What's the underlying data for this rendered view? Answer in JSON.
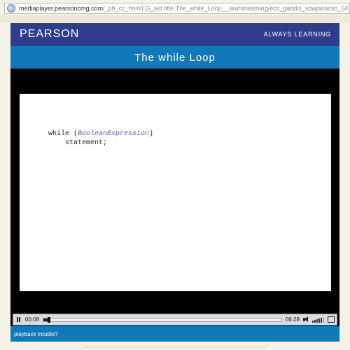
{
  "browser": {
    "url_host": "mediaplayer.pearsoncmg.com",
    "url_path": "/_ph_cc_hsmlLG_set.title.The_while_Loop__/aw/streaming/ecs_gaddis_sowjavacso_5/C"
  },
  "header": {
    "logo": "PEARSON",
    "tagline": "ALWAYS LEARNING"
  },
  "video": {
    "title": "The while Loop",
    "code_keyword": "while (",
    "code_expression": "BooleanExpression",
    "code_close": ")",
    "code_statement": "statement;"
  },
  "controls": {
    "current_time": "00:08",
    "duration": "06:28",
    "progress": 0.02,
    "volume_level": 0.75
  },
  "footer": {
    "trouble_link": "playback trouble?"
  }
}
